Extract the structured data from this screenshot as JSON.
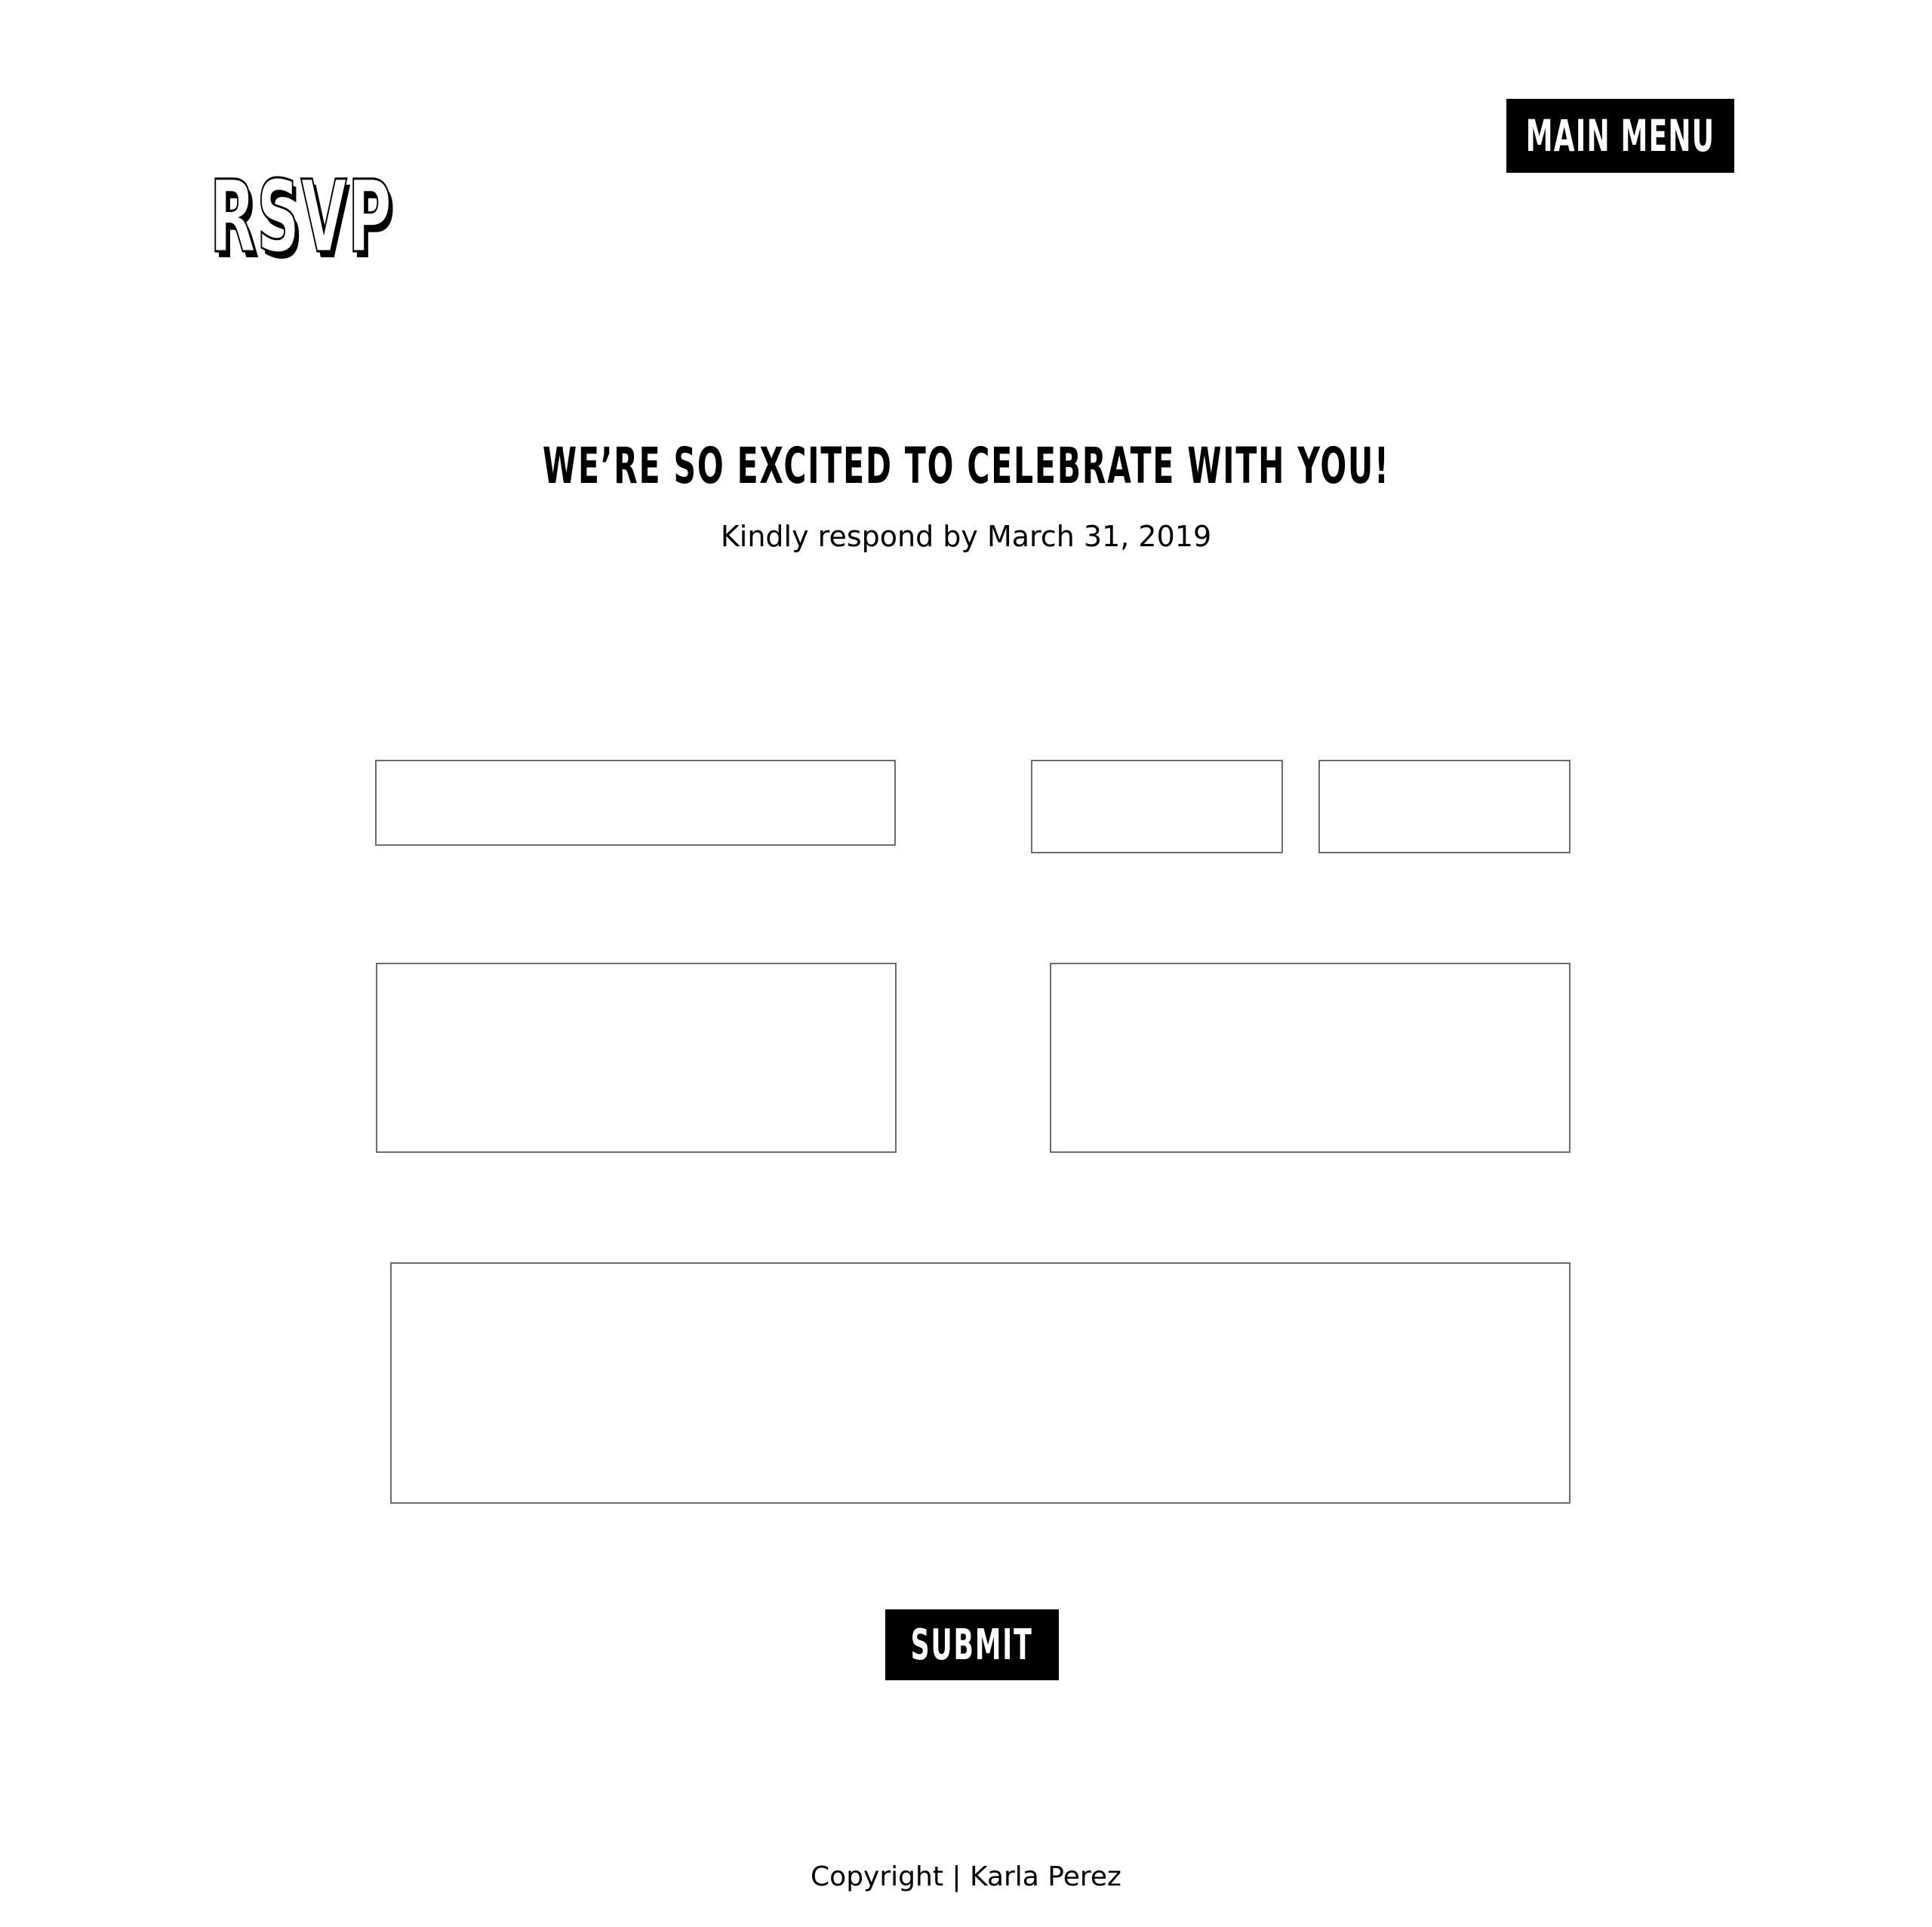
{
  "header": {
    "logo_text": "RSVP",
    "main_menu_label": "MAIN MENU"
  },
  "intro": {
    "headline": "WE’RE SO EXCITED TO CELEBRATE WITH YOU!",
    "subline": "Kindly respond by March 31, 2019"
  },
  "form": {
    "fields": [
      {
        "value": "",
        "placeholder": ""
      },
      {
        "value": "",
        "placeholder": ""
      },
      {
        "value": "",
        "placeholder": ""
      },
      {
        "value": "",
        "placeholder": ""
      },
      {
        "value": "",
        "placeholder": ""
      },
      {
        "value": "",
        "placeholder": ""
      }
    ],
    "submit_label": "SUBMIT"
  },
  "footer": {
    "copyright": "Copyright | Karla Perez"
  },
  "colors": {
    "background": "#ffffff",
    "text": "#000000",
    "button_bg": "#000000",
    "button_text": "#ffffff",
    "field_border": "#6b6b6b"
  }
}
